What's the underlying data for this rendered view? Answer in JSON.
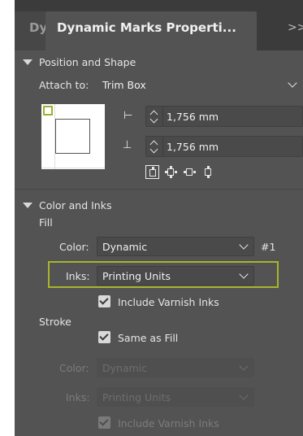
{
  "panel": {
    "tab_left_label": "Dy",
    "tab_title": "Dynamic Marks Properti...",
    "more_glyph": ">>"
  },
  "position_shape": {
    "header": "Position and Shape",
    "attach_label": "Attach to:",
    "attach_value": "Trim Box",
    "horizontal_offset": "1,756 mm",
    "vertical_offset": "1,756 mm"
  },
  "color_inks": {
    "header": "Color and Inks",
    "fill_label": "Fill",
    "fill_color_label": "Color:",
    "fill_color_value": "Dynamic",
    "fill_color_index": "#1",
    "fill_inks_label": "Inks:",
    "fill_inks_value": "Printing Units",
    "include_varnish_label": "Include Varnish Inks",
    "stroke_label": "Stroke",
    "same_as_fill_label": "Same as Fill",
    "stroke_color_label": "Color:",
    "stroke_color_value": "Dynamic",
    "stroke_inks_label": "Inks:",
    "stroke_inks_value": "Printing Units",
    "stroke_include_varnish_label": "Include Varnish Inks"
  },
  "colors": {
    "panel_bg": "#535353",
    "highlight": "#a7b52a"
  }
}
